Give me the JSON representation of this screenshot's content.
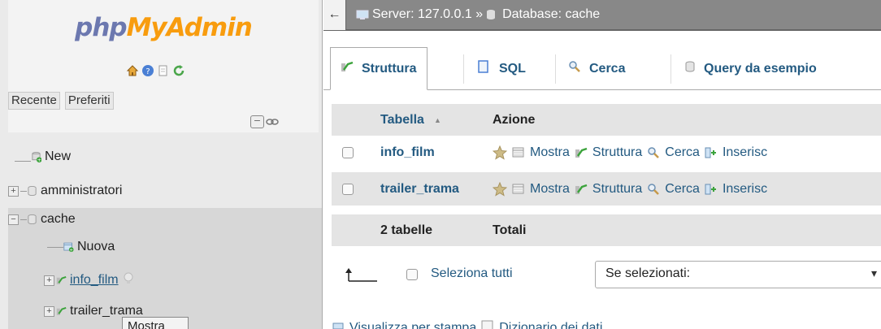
{
  "nav": {
    "logo_part1": "php",
    "logo_part2": "MyAdmin",
    "icons": [
      "home-icon",
      "help-icon",
      "docs-icon",
      "reload-icon"
    ],
    "recent_label": "Recente",
    "favorites_label": "Preferiti",
    "tree": {
      "new_label": "New",
      "db1": "amministratori",
      "db2": "cache",
      "new_table_label": "Nuova",
      "table1": "info_film",
      "table2": "trailer_trama"
    },
    "tooltip": "Mostra"
  },
  "breadcrumb": {
    "back": "←",
    "server_label": "Server: 127.0.0.1 »",
    "database_label": "Database: cache"
  },
  "tabs": [
    {
      "label": "Struttura"
    },
    {
      "label": "SQL"
    },
    {
      "label": "Cerca"
    },
    {
      "label": "Query da esempio"
    }
  ],
  "table": {
    "col_table": "Tabella",
    "sort_indicator": "▲",
    "col_action": "Azione",
    "rows": [
      {
        "name": "info_film"
      },
      {
        "name": "trailer_trama"
      }
    ],
    "actions": {
      "browse": "Mostra",
      "structure": "Struttura",
      "search": "Cerca",
      "insert": "Inserisc"
    },
    "footer_count": "2 tabelle",
    "footer_totals": "Totali"
  },
  "bulk": {
    "select_all": "Seleziona tutti",
    "with_selected": "Se selezionati:"
  },
  "bottom": {
    "print": "Visualizza per stampa",
    "dictionary": "Dizionario dei dati"
  }
}
